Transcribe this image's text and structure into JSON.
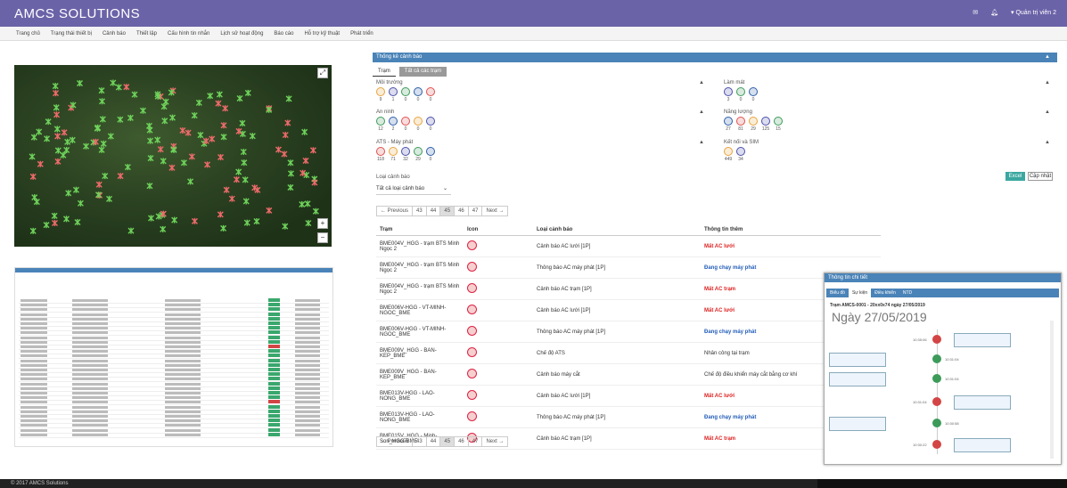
{
  "app": {
    "title": "AMCS SOLUTIONS",
    "user": "Quản trị viên 2",
    "footer": "© 2017 AMCS Solutions"
  },
  "nav": [
    "Trang chủ",
    "Trạng thái thiết bị",
    "Cảnh báo",
    "Thiết lập",
    "Cấu hình tin nhắn",
    "Lịch sử hoạt động",
    "Báo cáo",
    "Hỗ trợ kỹ thuật",
    "Phát triển"
  ],
  "panel": {
    "title": "Thống kê cảnh báo",
    "tabs": [
      "Trạm",
      "Tất cả các trạm"
    ],
    "groups": [
      {
        "label": "Môi trường",
        "counts": [
          "9",
          "1",
          "0",
          "0",
          "0"
        ]
      },
      {
        "label": "Làm mát",
        "counts": [
          "3",
          "0",
          "0"
        ]
      },
      {
        "label": "An ninh",
        "counts": [
          "12",
          "2",
          "0",
          "0",
          "0"
        ]
      },
      {
        "label": "Năng lượng",
        "counts": [
          "27",
          "81",
          "29",
          "125",
          "15"
        ]
      },
      {
        "label": "ATS - Máy phát",
        "counts": [
          "118",
          "71",
          "32",
          "29",
          "0"
        ]
      },
      {
        "label": "Kết nối và SIM",
        "counts": [
          "449",
          "34"
        ]
      }
    ],
    "excel": "Excel",
    "update": "Cập nhật",
    "type_label": "Loại cảnh báo",
    "type_value": "Tất cả loại cảnh báo",
    "pager": [
      "← Previous",
      "43",
      "44",
      "45",
      "46",
      "47",
      "Next →"
    ],
    "columns": [
      "Trạm",
      "Icon",
      "Loại cảnh báo",
      "Thông tin thêm"
    ],
    "rows": [
      {
        "station": "BME004V_HGG - trạm BTS Minh Ngọc 2",
        "type": "Cảnh báo AC lưới [1P]",
        "info": "Mất AC lưới",
        "cls": "red"
      },
      {
        "station": "BME004V_HGG - trạm BTS Minh Ngọc 2",
        "type": "Thông báo AC máy phát [1P]",
        "info": "Đang chạy máy phát",
        "cls": "blue"
      },
      {
        "station": "BME004V_HGG - trạm BTS Minh Ngọc 2",
        "type": "Cảnh báo AC trạm [1P]",
        "info": "Mất AC trạm",
        "cls": "red"
      },
      {
        "station": "BME006V-HGG - VT-MINH-NGOC_BME",
        "type": "Cảnh báo AC lưới [1P]",
        "info": "Mất AC lưới",
        "cls": "red"
      },
      {
        "station": "BME006V-HGG - VT-MINH-NGOC_BME",
        "type": "Thông báo AC máy phát [1P]",
        "info": "Đang chạy máy phát",
        "cls": "blue"
      },
      {
        "station": "BME009V_HGG - BAN-KEP_BME",
        "type": "Chế độ ATS",
        "info": "Nhân công tại trạm",
        "cls": ""
      },
      {
        "station": "BME009V_HGG - BAN-KEP_BME",
        "type": "Cảnh báo máy cắt",
        "info": "Chế độ điều khiển máy cắt bằng cơ khí",
        "cls": ""
      },
      {
        "station": "BME013V-HGG - LAO-NONG_BME",
        "type": "Cảnh báo AC lưới [1P]",
        "info": "Mất AC lưới",
        "cls": "red"
      },
      {
        "station": "BME013V-HGG - LAO-NONG_BME",
        "type": "Thông báo AC máy phát [1P]",
        "info": "Đang chạy máy phát",
        "cls": "blue"
      },
      {
        "station": "BME015V_HGG - Minh-Son_HGG-BME",
        "type": "Cảnh báo AC trạm [1P]",
        "info": "Mất AC trạm",
        "cls": "red"
      }
    ]
  },
  "popup": {
    "title": "Thông tin chi tiết",
    "tabs": [
      "Biểu đồ",
      "Sự kiện",
      "Điều khiển",
      "NTD"
    ],
    "station": "Trạm AMCS-0001 - 20xx0x74 ngày 27/05/2019",
    "date": "Ngày 27/05/2019",
    "events": [
      "10:35:06",
      "10:31:04",
      "10:31:04",
      "10:31:04",
      "10:30:58",
      "10:30:22"
    ]
  }
}
